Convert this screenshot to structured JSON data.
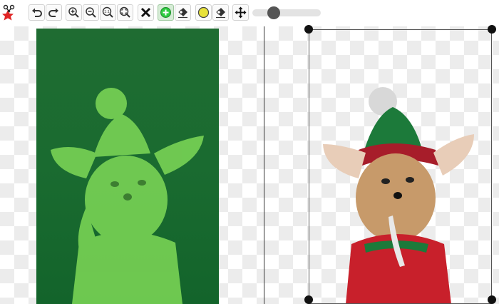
{
  "toolbar": {
    "logo_icon": "scissors-star-logo",
    "buttons": [
      {
        "name": "undo-button",
        "icon": "undo-icon"
      },
      {
        "name": "redo-button",
        "icon": "redo-icon"
      },
      {
        "name": "zoom-in-button",
        "icon": "zoom-in-icon"
      },
      {
        "name": "zoom-out-button",
        "icon": "zoom-out-icon"
      },
      {
        "name": "zoom-actual-button",
        "icon": "zoom-1to1-icon",
        "label": "1:1"
      },
      {
        "name": "zoom-fit-button",
        "icon": "zoom-fit-icon"
      },
      {
        "name": "clear-button",
        "icon": "close-icon"
      },
      {
        "name": "keep-brush-button",
        "icon": "plus-circle-icon",
        "active": true
      },
      {
        "name": "eraser-button",
        "icon": "eraser-icon"
      },
      {
        "name": "remove-brush-button",
        "icon": "yellow-circle-icon"
      },
      {
        "name": "eraser-2-button",
        "icon": "eraser-icon"
      },
      {
        "name": "pan-button",
        "icon": "move-icon"
      }
    ],
    "brush_size_slider": {
      "value": 0.22
    }
  },
  "colors": {
    "keep_marker": "#2ecc40",
    "remove_marker": "#e8e23a",
    "green_overlay": "#7ed957",
    "background_green": "#1a6b30"
  }
}
